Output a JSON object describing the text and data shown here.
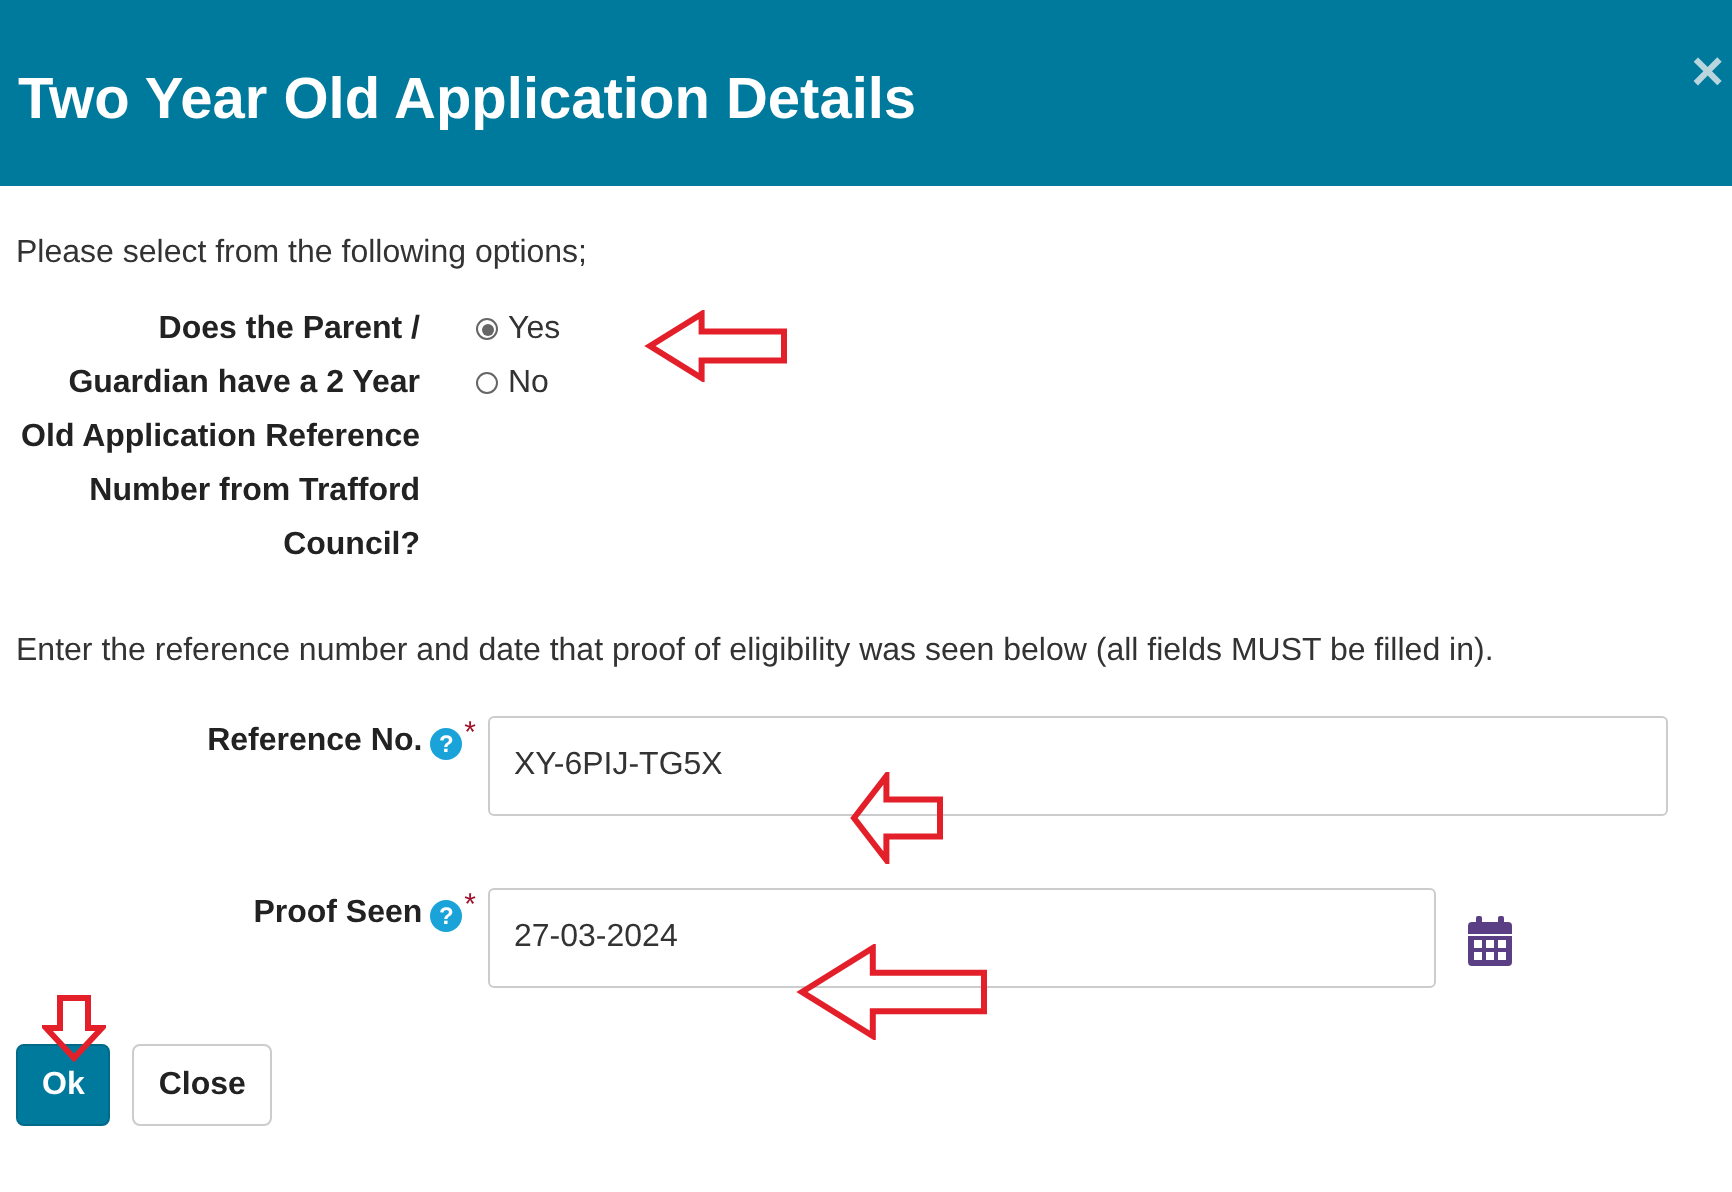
{
  "dialog": {
    "title": "Two Year Old Application Details",
    "close": "×"
  },
  "intro": "Please select from the following options;",
  "question": {
    "label": "Does the Parent / Guardian have a 2 Year Old Application Reference Number from Trafford Council?",
    "options": [
      {
        "label": "Yes",
        "selected": true
      },
      {
        "label": "No",
        "selected": false
      }
    ]
  },
  "instruction": "Enter the reference number and date that proof of eligibility was seen below (all fields MUST be filled in).",
  "fields": [
    {
      "kind": "text",
      "label": "Reference No.",
      "help": "?",
      "required_mark": "*",
      "value": "XY-6PIJ-TG5X"
    },
    {
      "kind": "date",
      "label": "Proof Seen",
      "help": "?",
      "required_mark": "*",
      "value": "27-03-2024"
    }
  ],
  "buttons": [
    {
      "label": "Ok",
      "kind": "primary"
    },
    {
      "label": "Close",
      "kind": "default"
    }
  ]
}
